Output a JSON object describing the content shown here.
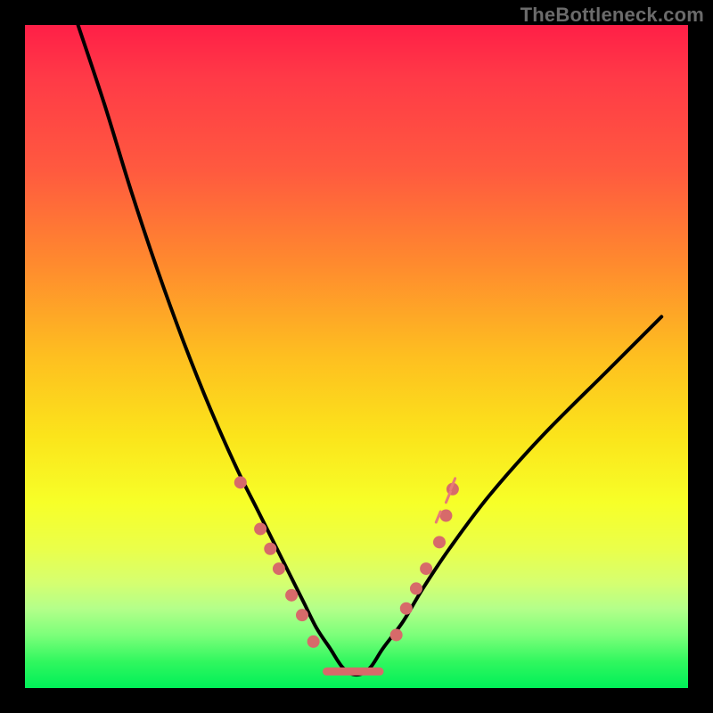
{
  "watermark": "TheBottleneck.com",
  "colors": {
    "background": "#000000",
    "curve": "#000000",
    "marker": "#d76a6a",
    "gradient_stops": [
      "#ff1f47",
      "#ff5a3f",
      "#febf20",
      "#f7ff28",
      "#7cff7a",
      "#00ef58"
    ]
  },
  "chart_data": {
    "type": "line",
    "title": "",
    "xlabel": "",
    "ylabel": "",
    "xlim": [
      0,
      100
    ],
    "ylim": [
      0,
      100
    ],
    "note": "No axis ticks or numeric labels are printed on the image; x and y are normalized 0–100. y represents a bottleneck-score-like quantity (red≈high, green≈low). The black curve is a V-shaped well with minimum near x≈49 at y≈2. Salmon dots mark sampled points along the curve near the well; a short flat salmon segment marks the well floor.",
    "series": [
      {
        "name": "curve",
        "x": [
          8,
          12,
          16,
          20,
          24,
          28,
          32,
          35,
          38,
          40,
          42,
          44,
          46,
          48,
          50,
          52,
          54,
          57,
          60,
          64,
          70,
          78,
          88,
          96
        ],
        "values": [
          100,
          88,
          75,
          63,
          52,
          42,
          33,
          27,
          21,
          17,
          13,
          9,
          6,
          3,
          2,
          3,
          6,
          10,
          15,
          21,
          29,
          38,
          48,
          56
        ]
      }
    ],
    "markers_left": [
      {
        "x": 32.5,
        "y": 31
      },
      {
        "x": 35.5,
        "y": 24
      },
      {
        "x": 37.0,
        "y": 21
      },
      {
        "x": 38.3,
        "y": 18
      },
      {
        "x": 40.2,
        "y": 14
      },
      {
        "x": 41.8,
        "y": 11
      },
      {
        "x": 43.5,
        "y": 7
      }
    ],
    "markers_right": [
      {
        "x": 56.0,
        "y": 8
      },
      {
        "x": 57.5,
        "y": 12
      },
      {
        "x": 59.0,
        "y": 15
      },
      {
        "x": 60.5,
        "y": 18
      },
      {
        "x": 62.5,
        "y": 22
      },
      {
        "x": 63.5,
        "y": 26
      },
      {
        "x": 64.5,
        "y": 30
      }
    ],
    "flat_segment": {
      "x0": 45.5,
      "x1": 53.5,
      "y": 2.5
    },
    "right_ticks": [
      {
        "x": 62.0,
        "y": 25
      },
      {
        "x": 63.5,
        "y": 28
      },
      {
        "x": 64.2,
        "y": 30
      }
    ]
  }
}
